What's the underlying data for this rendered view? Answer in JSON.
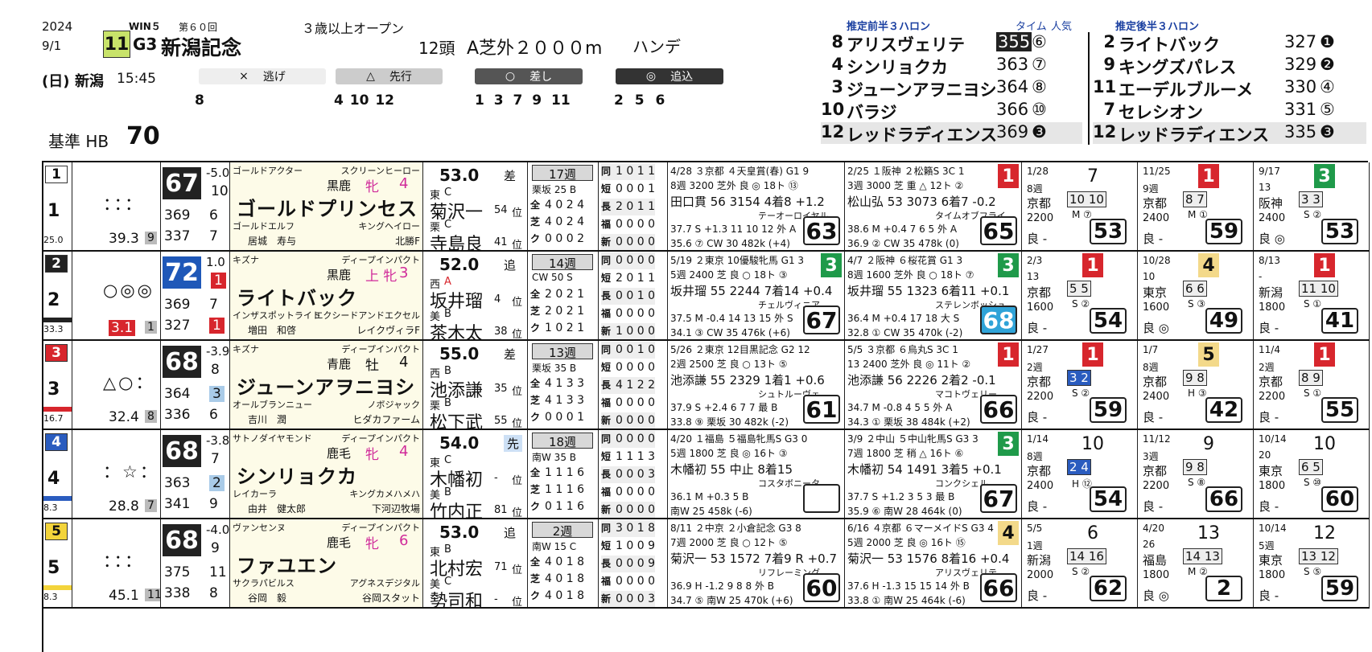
{
  "header": {
    "year": "2024",
    "date": "9/1",
    "win5": "WIN５",
    "kaisu": "第６０回",
    "race_no": "11",
    "grade": "G3",
    "race_name": "新潟記念",
    "condition": "３歳以上オープン",
    "heads": "12頭",
    "course": "A芝外２０００m",
    "handicap": "ハンデ",
    "day": "(日)",
    "venue": "新潟",
    "time": "15:45",
    "base": "基準 HB",
    "base_val": "70"
  },
  "styles": [
    {
      "icon": "×",
      "label": "逃げ",
      "nums": "8"
    },
    {
      "icon": "△",
      "label": "先行",
      "nums": "4 10 12"
    },
    {
      "icon": "○",
      "label": "差し",
      "nums": "1 3 7 9 11"
    },
    {
      "icon": "◎",
      "label": "追込",
      "nums": "2 5 6"
    }
  ],
  "pace": {
    "front_title": "推定前半３ハロン",
    "time_label": "タイム",
    "pop_label": "人気",
    "back_title": "推定後半３ハロン",
    "front": [
      {
        "no": "8",
        "name": "アリスヴェリテ",
        "time": "355",
        "pop": "⑥"
      },
      {
        "no": "4",
        "name": "シンリョクカ",
        "time": "363",
        "pop": "⑦"
      },
      {
        "no": "3",
        "name": "ジューンアヲニヨシ",
        "time": "364",
        "pop": "⑧"
      },
      {
        "no": "10",
        "name": "バラジ",
        "time": "366",
        "pop": "⑩"
      },
      {
        "no": "12",
        "name": "レッドラディエンス",
        "time": "369",
        "pop": "❸"
      }
    ],
    "back": [
      {
        "no": "2",
        "name": "ライトバック",
        "time": "327",
        "pop": "❶"
      },
      {
        "no": "9",
        "name": "キングズパレス",
        "time": "329",
        "pop": "❷"
      },
      {
        "no": "11",
        "name": "エーデルブルーメ",
        "time": "330",
        "pop": "④"
      },
      {
        "no": "7",
        "name": "セレシオン",
        "time": "331",
        "pop": "⑤"
      },
      {
        "no": "12",
        "name": "レッドラディエンス",
        "time": "335",
        "pop": "❸"
      }
    ]
  },
  "horses": [
    {
      "waku": "1",
      "uma": "1",
      "marks": "：：：",
      "odds": "39.3",
      "pop": "9",
      "rating": "25.0",
      "hb": "67",
      "hb_diff": "-5.0",
      "diff2": "10",
      "l1": "369",
      "l1r": "6",
      "l2": "337",
      "l2r": "7",
      "sire": "ゴールドアクター",
      "bms_sire": "スクリーンヒーロー",
      "coat": "黒鹿",
      "sex": "牝",
      "age": "4",
      "name": "ゴールドプリンセス",
      "dam": "ゴールドエルフ",
      "dam_sire": "キングヘイロー",
      "owner": "居城　寿与",
      "breeder": "北勝F",
      "weight": "53.0",
      "style": "差",
      "region1": "東",
      "rank1": "C",
      "jockey": "菊沢一",
      "j_rank": "54",
      "region2": "栗",
      "rank2": "C",
      "trainer": "寺島良",
      "t_rank": "41",
      "weeks": "17週",
      "work": "栗坂 25 B",
      "stats": [
        [
          "同",
          "1 0 1 1"
        ],
        [
          "短",
          "0 0 0 1"
        ],
        [
          "長",
          "2 0 1 1"
        ],
        [
          "福",
          "0 0 0 0"
        ],
        [
          "新",
          "0 0 0 0"
        ]
      ],
      "stats2": [
        [
          "全",
          "4 0 2 4"
        ],
        [
          "芝",
          "4 0 2 4"
        ],
        [
          "ク",
          "0 0 0 2"
        ]
      ],
      "r1": {
        "head": "4/28 ３京都 ４天皇賞(春) G1 9",
        "l2": "8週 3200 芝外 良 ◎ 18ト ⑬",
        "l3": "田口貫 56 3154 4着8 +1.2",
        "l4": "テーオーロイヤル",
        "l5": "37.7 S +1.3 11 10 12 外 A",
        "l6": "35.6 ⑦ CW 30 482k (+4)",
        "fig": "63",
        "fin": "9",
        "fc": "#fff"
      },
      "r2": {
        "head": "2/25 １阪神 ２松籟S 3C 1",
        "l2": "3週 3000 芝 重 △ 12ト ②",
        "l3": "松山弘 53 3073 6着7 -0.2",
        "l4": "タイムオブフライ",
        "l5": "38.6 M +0.4 7 6 5 外 A",
        "l6": "36.9 ② CW 35 478k (0)",
        "fig": "65",
        "fin": "1",
        "fc": "#d7262d"
      },
      "p": [
        {
          "d": "1/28",
          "f": "7",
          "fc": "",
          "w": "8週",
          "c": "京都",
          "dist": "2200",
          "pos": "10 10",
          "pc": "M ⑦",
          "s": "良 -",
          "fig": "53"
        },
        {
          "d": "11/25",
          "f": "1",
          "fc": "#d7262d",
          "w": "9週",
          "c": "京都",
          "dist": "2400",
          "pos": "8 7",
          "pc": "M ①",
          "s": "良 -",
          "fig": "59"
        },
        {
          "d": "9/17",
          "f": "3",
          "fc": "#1f9a4a",
          "w": "13",
          "c": "阪神",
          "dist": "2400",
          "pos": "3 3",
          "pc": "S ②",
          "s": "良 ◎",
          "fig": "53"
        }
      ]
    },
    {
      "waku": "2",
      "uma": "2",
      "marks": "○◎◎",
      "odds": "3.1",
      "pop": "1",
      "rating": "33.3",
      "hb": "72",
      "hb_diff": "1.0",
      "diff2": "1",
      "l1": "369",
      "l1r": "7",
      "l2": "327",
      "l2r": "1",
      "sire": "キズナ",
      "bms_sire": "ディープインパクト",
      "coat": "黒鹿",
      "sex": "上 牝",
      "age": "3",
      "name": "ライトバック",
      "dam": "インザスポットライト",
      "dam_sire": "エクシードアンドエクセル",
      "owner": "増田　和啓",
      "breeder": "レイクヴィラF",
      "weight": "52.0",
      "style": "追",
      "region1": "西",
      "rank1": "A",
      "jockey": "坂井瑠",
      "j_rank": "4",
      "region2": "美",
      "rank2": "B",
      "trainer": "茶木太",
      "t_rank": "38",
      "weeks": "14週",
      "work": "CW 50 S",
      "stats": [
        [
          "同",
          "0 0 0 0"
        ],
        [
          "短",
          "2 0 1 1"
        ],
        [
          "長",
          "0 0 1 0"
        ],
        [
          "福",
          "0 0 0 0"
        ],
        [
          "新",
          "1 0 0 0"
        ]
      ],
      "stats2": [
        [
          "全",
          "2 0 2 1"
        ],
        [
          "芝",
          "2 0 2 1"
        ],
        [
          "ク",
          "1 0 2 1"
        ]
      ],
      "r1": {
        "head": "5/19 ２東京 10優駿牝馬 G1 3",
        "l2": "5週 2400 芝 良 ○ 18ト ③",
        "l3": "坂井瑠 55 2244 7着14 +0.4",
        "l4": "チェルヴィニア",
        "l5": "37.5 M -0.4 14 13 15 外 S",
        "l6": "34.1 ③ CW 35 476k (+6)",
        "fig": "67",
        "fin": "3",
        "fc": "#1f9a4a"
      },
      "r2": {
        "head": "4/7 ２阪神 ６桜花賞 G1 3",
        "l2": "8週 1600 芝外 良 ○ 18ト ⑦",
        "l3": "坂井瑠 55 1323 6着11 +0.1",
        "l4": "ステレンボッシュ",
        "l5": "36.4 M +0.4 17 18 大 S",
        "l6": "32.8 ① CW 35 470k (-2)",
        "fig": "68",
        "fin": "3",
        "fc": "#1f9a4a"
      },
      "p": [
        {
          "d": "2/3",
          "f": "1",
          "fc": "#d7262d",
          "w": "13",
          "c": "京都",
          "dist": "1600",
          "pos": "5 5",
          "pc": "S ②",
          "s": "良 -",
          "fig": "54"
        },
        {
          "d": "10/28",
          "f": "4",
          "fc": "#f3d98a",
          "w": "10",
          "c": "東京",
          "dist": "1600",
          "pos": "6 6",
          "pc": "S ③",
          "s": "良 ◎",
          "fig": "49"
        },
        {
          "d": "8/13",
          "f": "1",
          "fc": "#d7262d",
          "w": "-",
          "c": "新潟",
          "dist": "1800",
          "pos": "11 10",
          "pc": "S ①",
          "s": "良 -",
          "fig": "41"
        }
      ]
    },
    {
      "waku": "3",
      "uma": "3",
      "marks": "△○：",
      "odds": "32.4",
      "pop": "8",
      "rating": "16.7",
      "hb": "68",
      "hb_diff": "-3.9",
      "diff2": "8",
      "l1": "364",
      "l1r": "3",
      "l2": "336",
      "l2r": "6",
      "sire": "キズナ",
      "bms_sire": "ディープインパクト",
      "coat": "青鹿",
      "sex": "牡",
      "age": "4",
      "name": "ジューンアヲニヨシ",
      "dam": "オールブランニュー",
      "dam_sire": "ノボジャック",
      "owner": "吉川　潤",
      "breeder": "ヒダカファーム",
      "weight": "55.0",
      "style": "差",
      "region1": "西",
      "rank1": "B",
      "jockey": "池添謙",
      "j_rank": "35",
      "region2": "栗",
      "rank2": "B",
      "trainer": "松下武",
      "t_rank": "55",
      "weeks": "13週",
      "work": "栗坂 35 B",
      "stats": [
        [
          "同",
          "0 0 1 0"
        ],
        [
          "短",
          "0 0 0 0"
        ],
        [
          "長",
          "4 1 2 2"
        ],
        [
          "福",
          "0 0 0 0"
        ],
        [
          "新",
          "0 0 0 0"
        ]
      ],
      "stats2": [
        [
          "全",
          "4 1 3 3"
        ],
        [
          "芝",
          "4 1 3 3"
        ],
        [
          "ク",
          "0 0 0 1"
        ]
      ],
      "r1": {
        "head": "5/26 ２東京 12目黒記念 G2 12",
        "l2": "2週 2500 芝 良 ○ 13ト ⑤",
        "l3": "池添謙 55 2329 1着1 +0.6",
        "l4": "シュトルーヴェ",
        "l5": "37.9 S +2.4 6 7 7 最 B",
        "l6": "33.8 ⑨ 栗坂 30 482k (-2)",
        "fig": "61",
        "fin": "12",
        "fc": "#fff"
      },
      "r2": {
        "head": "5/5 ３京都 ６烏丸S 3C 1",
        "l2": "13 2400 芝外 良 ◎ 11ト ②",
        "l3": "池添謙 56 2226 2着2 -0.1",
        "l4": "マコトヴェリー",
        "l5": "34.7 M -0.8 4 5 5 外 A",
        "l6": "34.3 ① 栗坂 38 484k (+2)",
        "fig": "66",
        "fin": "1",
        "fc": "#d7262d"
      },
      "p": [
        {
          "d": "1/27",
          "f": "1",
          "fc": "#d7262d",
          "w": "2週",
          "c": "京都",
          "dist": "2200",
          "pos": "3 2",
          "pc": "S ②",
          "s": "良 -",
          "fig": "59"
        },
        {
          "d": "1/7",
          "f": "5",
          "fc": "#f3d98a",
          "w": "8週",
          "c": "京都",
          "dist": "2400",
          "pos": "9 8",
          "pc": "H ③",
          "s": "良 -",
          "fig": "42"
        },
        {
          "d": "11/4",
          "f": "1",
          "fc": "#d7262d",
          "w": "2週",
          "c": "京都",
          "dist": "2200",
          "pos": "8 9",
          "pc": "S ①",
          "s": "良 -",
          "fig": "55"
        }
      ]
    },
    {
      "waku": "4",
      "uma": "4",
      "marks": "：☆：",
      "odds": "28.8",
      "pop": "7",
      "rating": "8.3",
      "hb": "68",
      "hb_diff": "-3.8",
      "diff2": "7",
      "l1": "363",
      "l1r": "2",
      "l2": "341",
      "l2r": "9",
      "sire": "サトノダイヤモンド",
      "bms_sire": "ディープインパクト",
      "coat": "鹿毛",
      "sex": "牝",
      "age": "4",
      "name": "シンリョクカ",
      "dam": "レイカーラ",
      "dam_sire": "キングカメハメハ",
      "owner": "由井　健太郎",
      "breeder": "下河辺牧場",
      "weight": "54.0",
      "style": "先",
      "region1": "東",
      "rank1": "C",
      "jockey": "木幡初",
      "j_rank": "-",
      "region2": "美",
      "rank2": "B",
      "trainer": "竹内正",
      "t_rank": "81",
      "weeks": "18週",
      "work": "南W 35 B",
      "stats": [
        [
          "同",
          "0 0 0 0"
        ],
        [
          "短",
          "1 1 1 3"
        ],
        [
          "長",
          "0 0 0 3"
        ],
        [
          "福",
          "0 0 0 0"
        ],
        [
          "新",
          "0 0 0 0"
        ]
      ],
      "stats2": [
        [
          "全",
          "1 1 1 6"
        ],
        [
          "芝",
          "1 1 1 6"
        ],
        [
          "ク",
          "0 1 1 6"
        ]
      ],
      "r1": {
        "head": "4/20 １福島 ５福島牝馬S G3 0",
        "l2": "5週 1800 芝 良 ◎ 16ト ③",
        "l3": "木幡初 55 中止 8着15",
        "l4": "コスタボニータ",
        "l5": "36.1 M +0.3 5 B",
        "l6": "南W 25 458k (-6)",
        "fig": "",
        "fin": "0",
        "fc": "#fff"
      },
      "r2": {
        "head": "3/9 ２中山 ５中山牝馬S G3 3",
        "l2": "7週 1800 芝 稍 △ 16ト ⑥",
        "l3": "木幡初 54 1491 3着5 +0.1",
        "l4": "コンクシェル",
        "l5": "37.7 S +1.2 3 5 3 最 B",
        "l6": "35.9 ⑥ 南W 28 464k (0)",
        "fig": "67",
        "fin": "3",
        "fc": "#1f9a4a"
      },
      "p": [
        {
          "d": "1/14",
          "f": "10",
          "fc": "",
          "w": "8週",
          "c": "京都",
          "dist": "2400",
          "pos": "2 4",
          "pc": "H ⑫",
          "s": "良 -",
          "fig": "54"
        },
        {
          "d": "11/12",
          "f": "9",
          "fc": "",
          "w": "3週",
          "c": "京都",
          "dist": "2200",
          "pos": "9 8",
          "pc": "S ⑧",
          "s": "良 -",
          "fig": "66"
        },
        {
          "d": "10/14",
          "f": "10",
          "fc": "",
          "w": "20",
          "c": "東京",
          "dist": "1800",
          "pos": "6 5",
          "pc": "S ⑩",
          "s": "良 -",
          "fig": "60"
        }
      ]
    },
    {
      "waku": "5",
      "uma": "5",
      "marks": "：：：",
      "odds": "45.1",
      "pop": "11",
      "rating": "8.3",
      "hb": "68",
      "hb_diff": "-4.0",
      "diff2": "9",
      "l1": "375",
      "l1r": "11",
      "l2": "338",
      "l2r": "8",
      "sire": "ヴァンセンヌ",
      "bms_sire": "ディープインパクト",
      "coat": "鹿毛",
      "sex": "牝",
      "age": "6",
      "name": "ファユエン",
      "dam": "サクラパビルス",
      "dam_sire": "アグネスデジタル",
      "owner": "谷岡　毅",
      "breeder": "谷岡スタット",
      "weight": "53.0",
      "style": "追",
      "region1": "東",
      "rank1": "B",
      "jockey": "北村宏",
      "j_rank": "71",
      "region2": "美",
      "rank2": "C",
      "trainer": "勢司和",
      "t_rank": "-",
      "weeks": "2週",
      "work": "南W 15 C",
      "stats": [
        [
          "同",
          "3 0 1 8"
        ],
        [
          "短",
          "1 0 0 9"
        ],
        [
          "長",
          "0 0 0 9"
        ],
        [
          "福",
          "0 0 0 0"
        ],
        [
          "新",
          "0 0 0 3"
        ]
      ],
      "stats2": [
        [
          "全",
          "4 0 1 8"
        ],
        [
          "芝",
          "4 0 1 8"
        ],
        [
          "ク",
          "4 0 1 8"
        ]
      ],
      "r1": {
        "head": "8/11 ２中京 ２小倉記念 G3 8",
        "l2": "7週 2000 芝 良 ○ 12ト ⑤",
        "l3": "菊沢一 53 1572 7着9 R +0.7",
        "l4": "リフレーミング",
        "l5": "36.9 H -1.2 9 8 8 外 B",
        "l6": "34.7 ⑤ 南W 25 470k (+6)",
        "fig": "60",
        "fin": "8",
        "fc": "#fff"
      },
      "r2": {
        "head": "6/16 ４京都 ６マーメイドS G3 4",
        "l2": "5週 2000 芝 良 ◎ 16ト ⑮",
        "l3": "菊沢一 53 1576 8着16 +0.4",
        "l4": "アリスヴェリテ",
        "l5": "37.6 H -1.3 15 15 14 外 B",
        "l6": "33.8 ① 南W 25 464k (-6)",
        "fig": "66",
        "fin": "4",
        "fc": "#f3d98a"
      },
      "p": [
        {
          "d": "5/5",
          "f": "6",
          "fc": "",
          "w": "1週",
          "c": "新潟",
          "dist": "2000",
          "pos": "14 16",
          "pc": "S ②",
          "s": "良 -",
          "fig": "62"
        },
        {
          "d": "4/20",
          "f": "13",
          "fc": "",
          "w": "26",
          "c": "福島",
          "dist": "1800",
          "pos": "14 13",
          "pc": "M ②",
          "s": "良 ◎",
          "fig": "2"
        },
        {
          "d": "10/14",
          "f": "12",
          "fc": "",
          "w": "5週",
          "c": "東京",
          "dist": "1800",
          "pos": "13 12",
          "pc": "S ⑤",
          "s": "良 -",
          "fig": "59"
        }
      ]
    }
  ],
  "colors": {
    "waku1": "#ffffff",
    "waku2": "#222222",
    "waku3": "#d7262d",
    "waku4": "#2a5cbf",
    "waku5": "#f3d43b",
    "hb_box": "#222222",
    "hb_best": "#1f58b8",
    "red": "#d7262d",
    "green": "#1f9a4a",
    "yellow": "#f3d98a"
  }
}
